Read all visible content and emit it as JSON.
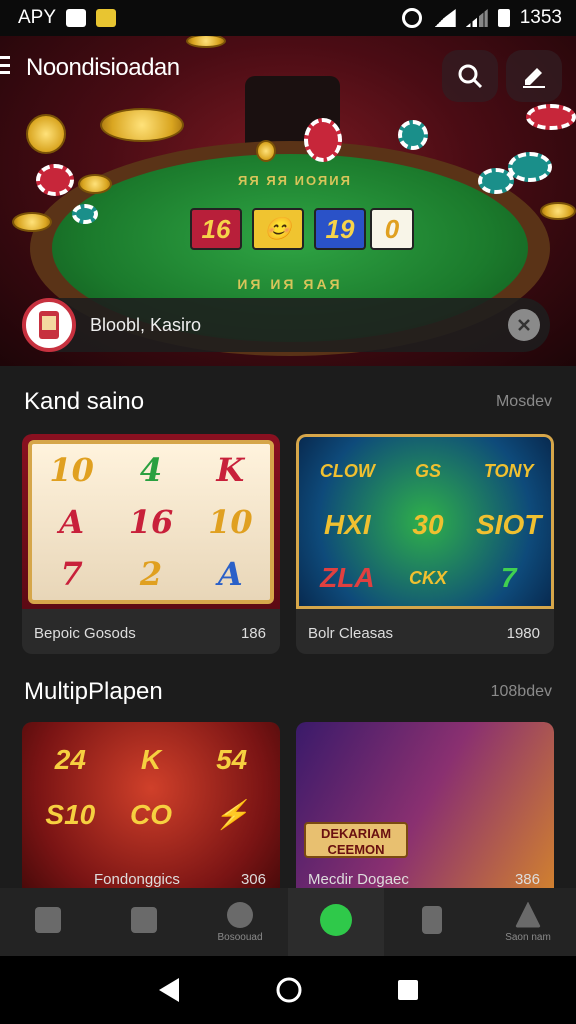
{
  "status_bar": {
    "left_text": "APY",
    "time": "1353"
  },
  "header": {
    "title": "Noondisioadan",
    "search_icon": "search-icon",
    "edit_icon": "edit-icon"
  },
  "hero": {
    "felt_text_top": "ЯЯ ЯЯ ИОЯИЯ",
    "felt_text_bottom": "ИЯ ИЯ ЯАЯ",
    "cards": [
      "16",
      "😊",
      "19",
      "0"
    ]
  },
  "search": {
    "value": "Bloobl, Kasiro"
  },
  "sections": [
    {
      "title": "Kand saino",
      "more": "Mosdev",
      "cards": [
        {
          "name": "Bepoic Gosods",
          "count": "186",
          "symbols": [
            "10",
            "4",
            "K",
            "A",
            "16",
            "10",
            "7",
            "2",
            "A"
          ]
        },
        {
          "name": "Bolr Cleasas",
          "count": "1980",
          "symbols": [
            "CLOW",
            "GS",
            "TONY",
            "HXI",
            "30",
            "SIOT",
            "ZLA",
            "CKX",
            "7"
          ]
        }
      ]
    },
    {
      "title": "MultipPlapen",
      "more": "108bdev",
      "cards": [
        {
          "name": "Fondonggics",
          "count": "306",
          "symbols": [
            "24",
            "K",
            "54",
            "S10",
            "CO",
            "⚡"
          ]
        },
        {
          "name": "Mecdir Dogaec",
          "count": "386",
          "banner": "DEKARIAM CEEMON"
        }
      ]
    }
  ],
  "bottom_nav": [
    {
      "label": "",
      "icon": "bag-icon"
    },
    {
      "label": "",
      "icon": "ticket-icon"
    },
    {
      "label": "Bosoouad",
      "icon": "tools-icon"
    },
    {
      "label": "",
      "icon": "chat-icon",
      "active": true
    },
    {
      "label": "",
      "icon": "card-icon"
    },
    {
      "label": "Saon nam",
      "icon": "profile-icon"
    }
  ],
  "colors": {
    "accent_red": "#e0304a",
    "active_green": "#2fc94a",
    "felt": "#1b7a2c",
    "gold": "#d6a64a"
  }
}
